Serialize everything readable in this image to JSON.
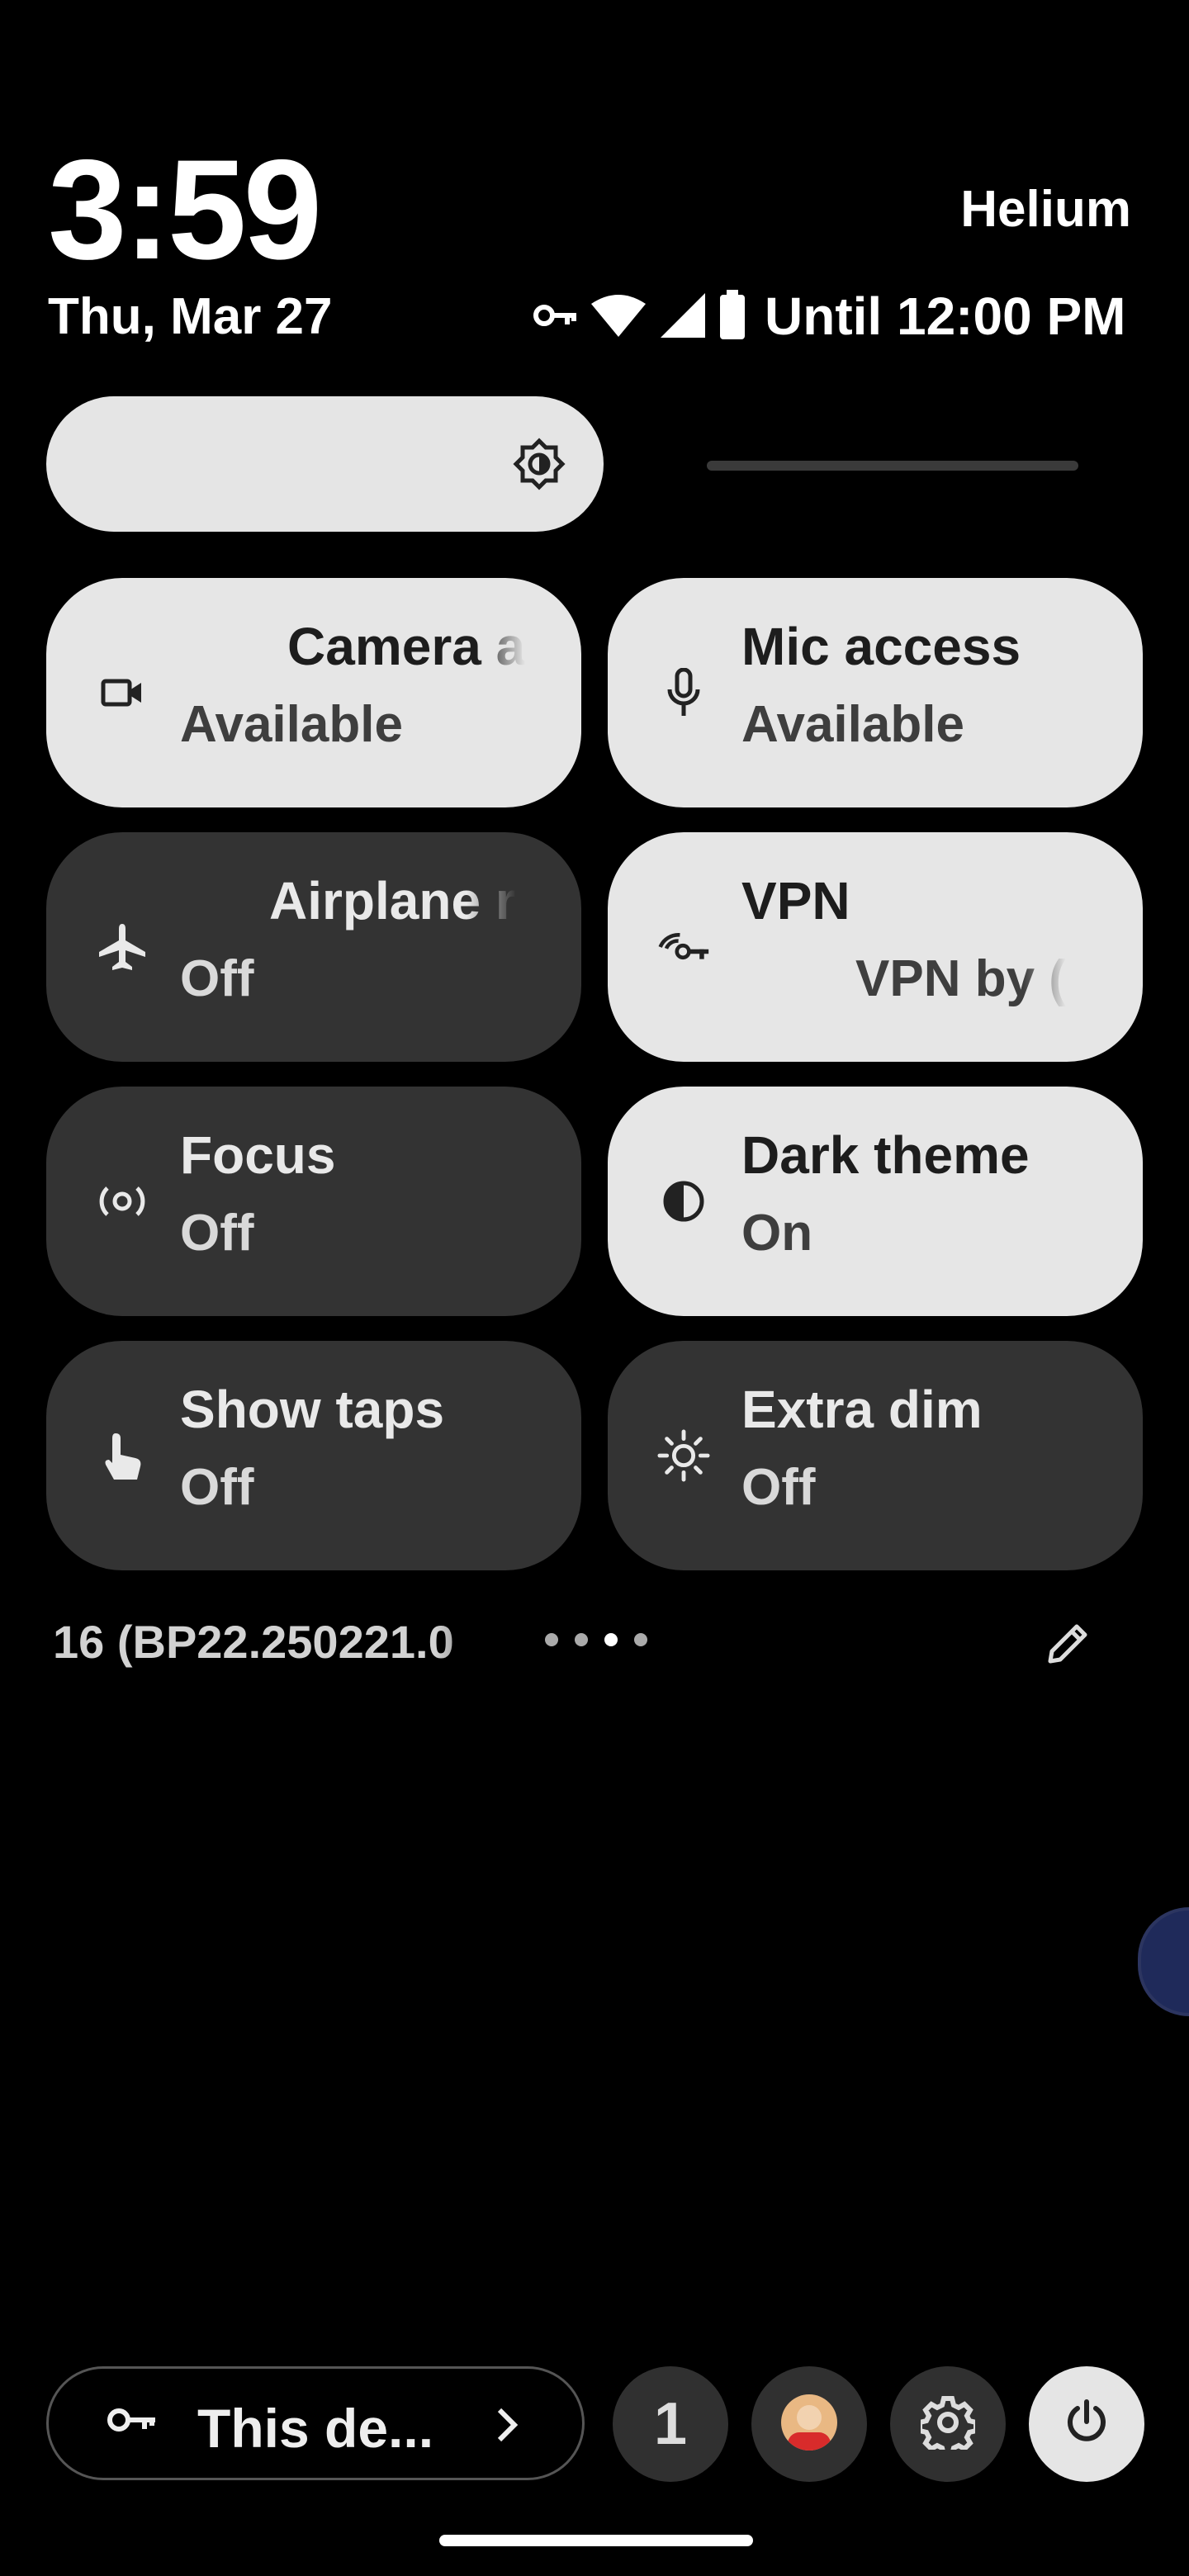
{
  "header": {
    "time": "3:59",
    "date": "Thu, Mar 27",
    "carrier": "Helium",
    "battery_text": "Until 12:00 PM",
    "status_icons": [
      "vpn-key-icon",
      "wifi-icon",
      "cell-signal-icon",
      "battery-icon"
    ]
  },
  "brightness": {
    "level": 0.54,
    "icon": "brightness-icon"
  },
  "tiles": [
    {
      "label": "Camera a",
      "state": "Available",
      "icon": "camera-icon",
      "on": true
    },
    {
      "label": "Mic access",
      "state": "Available",
      "icon": "mic-icon",
      "on": true
    },
    {
      "label": "Airplane r",
      "state": "Off",
      "icon": "airplane-icon",
      "on": false
    },
    {
      "label": "VPN",
      "state": "VPN by (",
      "icon": "vpn-key-icon",
      "on": true
    },
    {
      "label": "Focus",
      "state": "Off",
      "icon": "focus-icon",
      "on": false
    },
    {
      "label": "Dark theme",
      "state": "On",
      "icon": "dark-theme-icon",
      "on": true
    },
    {
      "label": "Show taps",
      "state": "Off",
      "icon": "touch-icon",
      "on": false
    },
    {
      "label": "Extra dim",
      "state": "Off",
      "icon": "extra-dim-icon",
      "on": false
    }
  ],
  "footer": {
    "build": "16 (BP22.250221.0",
    "page_dots": 4,
    "active_page": 3,
    "edit_icon": "pencil-icon"
  },
  "bottom_bar": {
    "disclosure_label": "This de...",
    "notification_count": "1",
    "user_icon": "avatar",
    "settings_icon": "gear-icon",
    "power_icon": "power-icon"
  },
  "colors": {
    "tile_on": "#e6e6e6",
    "tile_off": "#333333",
    "background": "#000000"
  }
}
